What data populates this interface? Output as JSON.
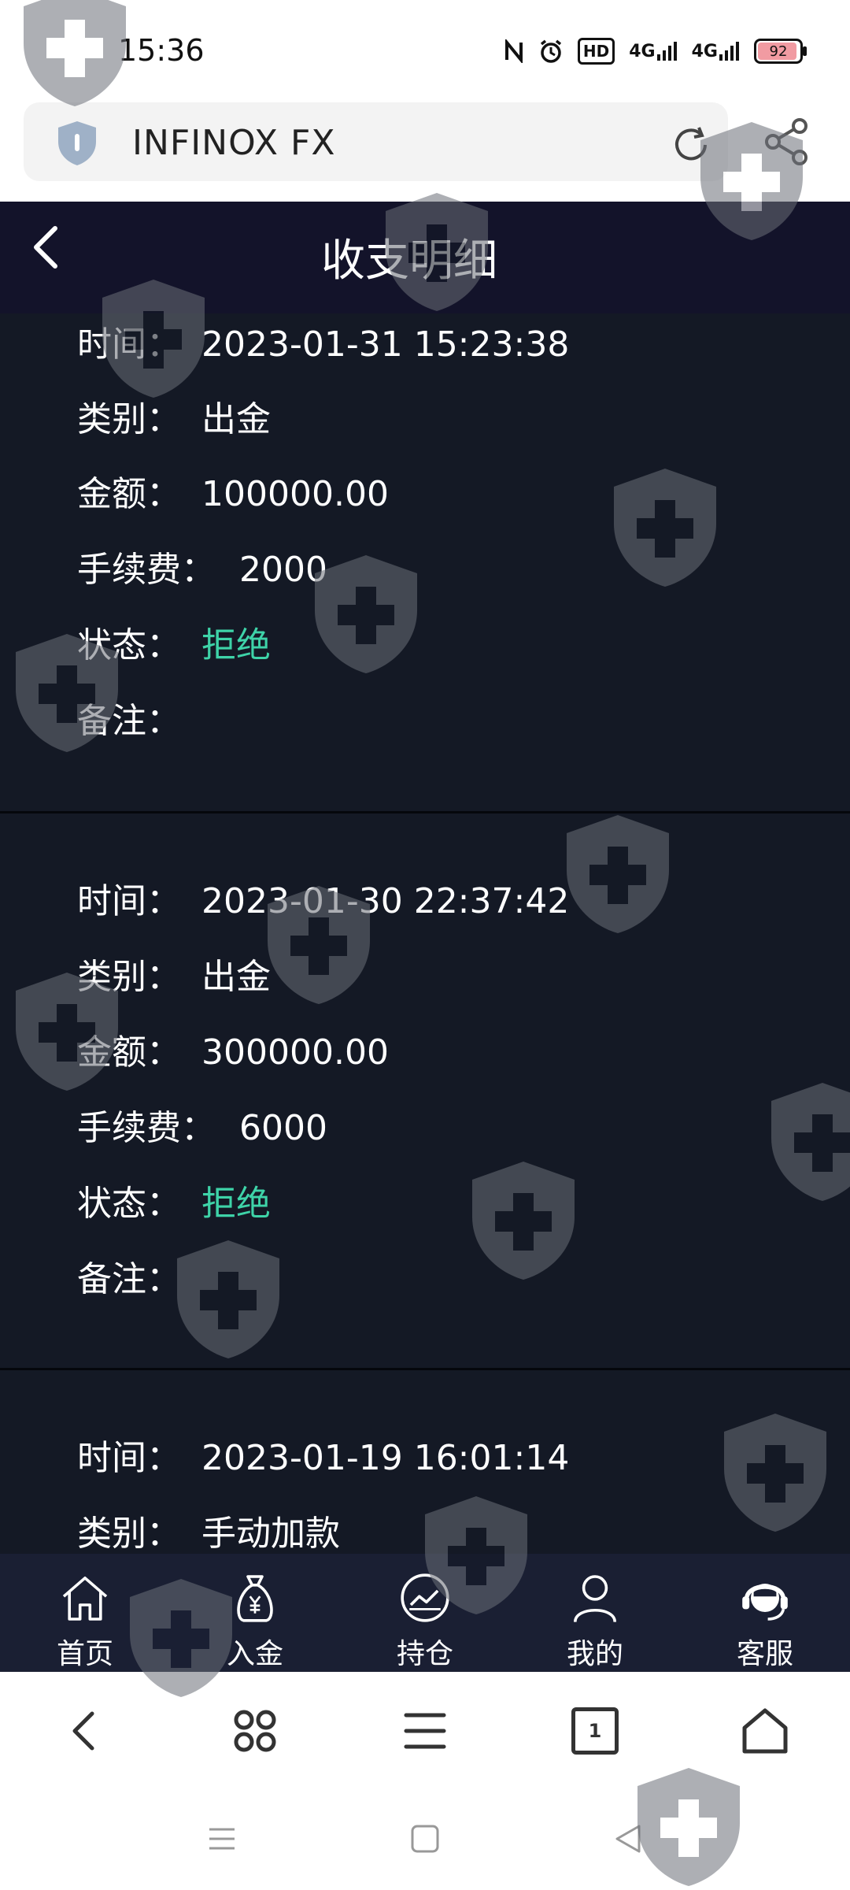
{
  "status_bar": {
    "time": "15:36",
    "icons": [
      "nfc-icon",
      "alarm-icon",
      "hd-icon",
      "4g-signal-icon",
      "4g-signal-icon"
    ],
    "hd_label": "HD",
    "net_label_1": "4G",
    "net_label_2": "4G",
    "battery": "92",
    "battery_level": 0.92
  },
  "browser": {
    "url": "INFINOX FX"
  },
  "header": {
    "title": "收支明细"
  },
  "labels": {
    "time": "时间：",
    "type": "类别：",
    "amount": "金额：",
    "fee": "手续费：",
    "status": "状态：",
    "note": "备注："
  },
  "records": [
    {
      "time": "2023-01-31 15:23:38",
      "type": "出金",
      "amount": "100000.00",
      "fee": "2000",
      "status": "拒绝",
      "note": ""
    },
    {
      "time": "2023-01-30 22:37:42",
      "type": "出金",
      "amount": "300000.00",
      "fee": "6000",
      "status": "拒绝",
      "note": ""
    },
    {
      "time": "2023-01-19 16:01:14",
      "type": "手动加款"
    }
  ],
  "tabs": [
    {
      "label": "首页",
      "icon": "home-icon"
    },
    {
      "label": "入金",
      "icon": "money-bag-icon"
    },
    {
      "label": "持仓",
      "icon": "chart-icon"
    },
    {
      "label": "我的",
      "icon": "user-icon"
    },
    {
      "label": "客服",
      "icon": "customer-service-icon"
    }
  ],
  "browser_nav": {
    "tab_count": "1"
  },
  "colors": {
    "header_bg": "#13132a",
    "content_bg": "#141925",
    "status_rejected": "#3ed3a8",
    "tab_bar_bg": "#1a1f33"
  }
}
